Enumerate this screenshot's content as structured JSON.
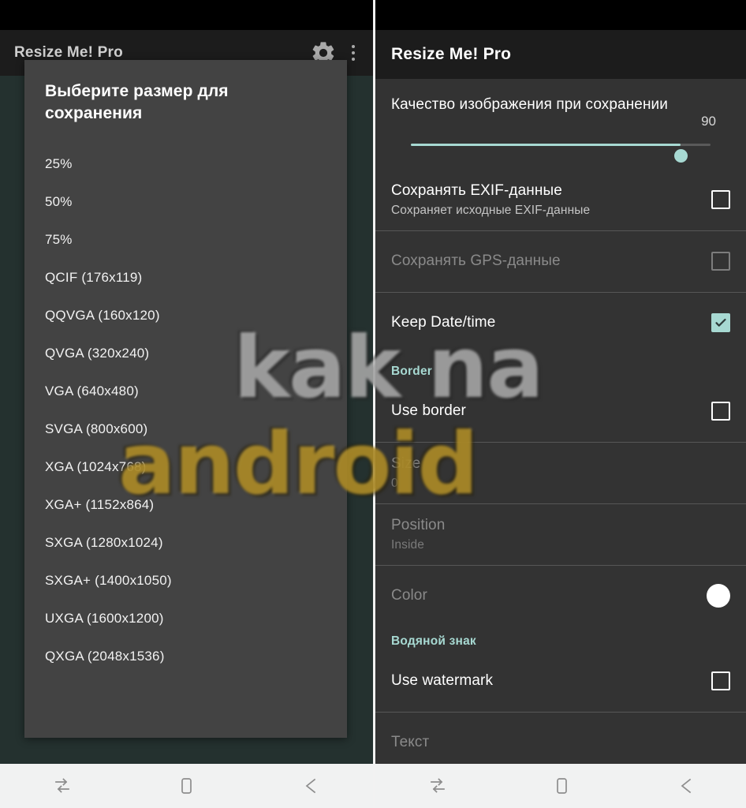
{
  "app": {
    "title": "Resize Me! Pro"
  },
  "left": {
    "appbar": {
      "title": "Resize Me! Pro",
      "gear_icon": "gear-icon",
      "overflow_icon": "overflow-menu-icon"
    },
    "dialog": {
      "title": "Выберите размер для сохранения",
      "items": [
        "25%",
        "50%",
        "75%",
        "QCIF (176x119)",
        "QQVGA (160x120)",
        "QVGA (320x240)",
        "VGA (640x480)",
        "SVGA (800x600)",
        "XGA (1024x768)",
        "XGA+ (1152x864)",
        "SXGA (1280x1024)",
        "SXGA+ (1400x1050)",
        "UXGA (1600x1200)",
        "QXGA (2048x1536)"
      ]
    }
  },
  "right": {
    "appbar": {
      "title": "Resize Me! Pro"
    },
    "quality": {
      "label": "Качество изображения при сохранении",
      "value": "90",
      "min": "0",
      "max": "100"
    },
    "rows": [
      {
        "title": "Сохранять EXIF-данные",
        "subtitle": "Сохраняет исходные EXIF-данные",
        "control": "checkbox",
        "state": "unchecked",
        "enabled": true
      },
      {
        "title": "Сохранять GPS-данные",
        "subtitle": "",
        "control": "checkbox",
        "state": "unchecked",
        "enabled": false
      },
      {
        "title": "Keep Date/time",
        "subtitle": "",
        "control": "checkbox",
        "state": "checked",
        "enabled": true
      }
    ],
    "section_border": {
      "label": "Border"
    },
    "border_rows": [
      {
        "title": "Use border",
        "subtitle": "",
        "control": "checkbox",
        "state": "unchecked",
        "enabled": true
      },
      {
        "title": "Size",
        "subtitle": "0",
        "control": "none",
        "enabled": false
      },
      {
        "title": "Position",
        "subtitle": "Inside",
        "control": "none",
        "enabled": false
      },
      {
        "title": "Color",
        "subtitle": "",
        "control": "colorswatch",
        "enabled": false
      }
    ],
    "section_watermark": {
      "label": "Водяной знак"
    },
    "watermark_rows": [
      {
        "title": "Use watermark",
        "subtitle": "",
        "control": "checkbox",
        "state": "unchecked",
        "enabled": true
      },
      {
        "title": "Текст",
        "subtitle": "",
        "control": "none",
        "enabled": false
      }
    ]
  },
  "navbar": {
    "recent_label": "recent-apps-icon",
    "home_label": "home-icon",
    "back_label": "back-icon"
  },
  "overlay_watermark": {
    "line1": "kak na",
    "line2": "android"
  },
  "colors": {
    "accent": "#a7d9d2",
    "dialog_bg": "#434343",
    "panel_bg": "#333333",
    "appbar_bg": "#1c1c1c",
    "navbar_bg": "#f1f2f2",
    "backdrop": "#24312f"
  }
}
